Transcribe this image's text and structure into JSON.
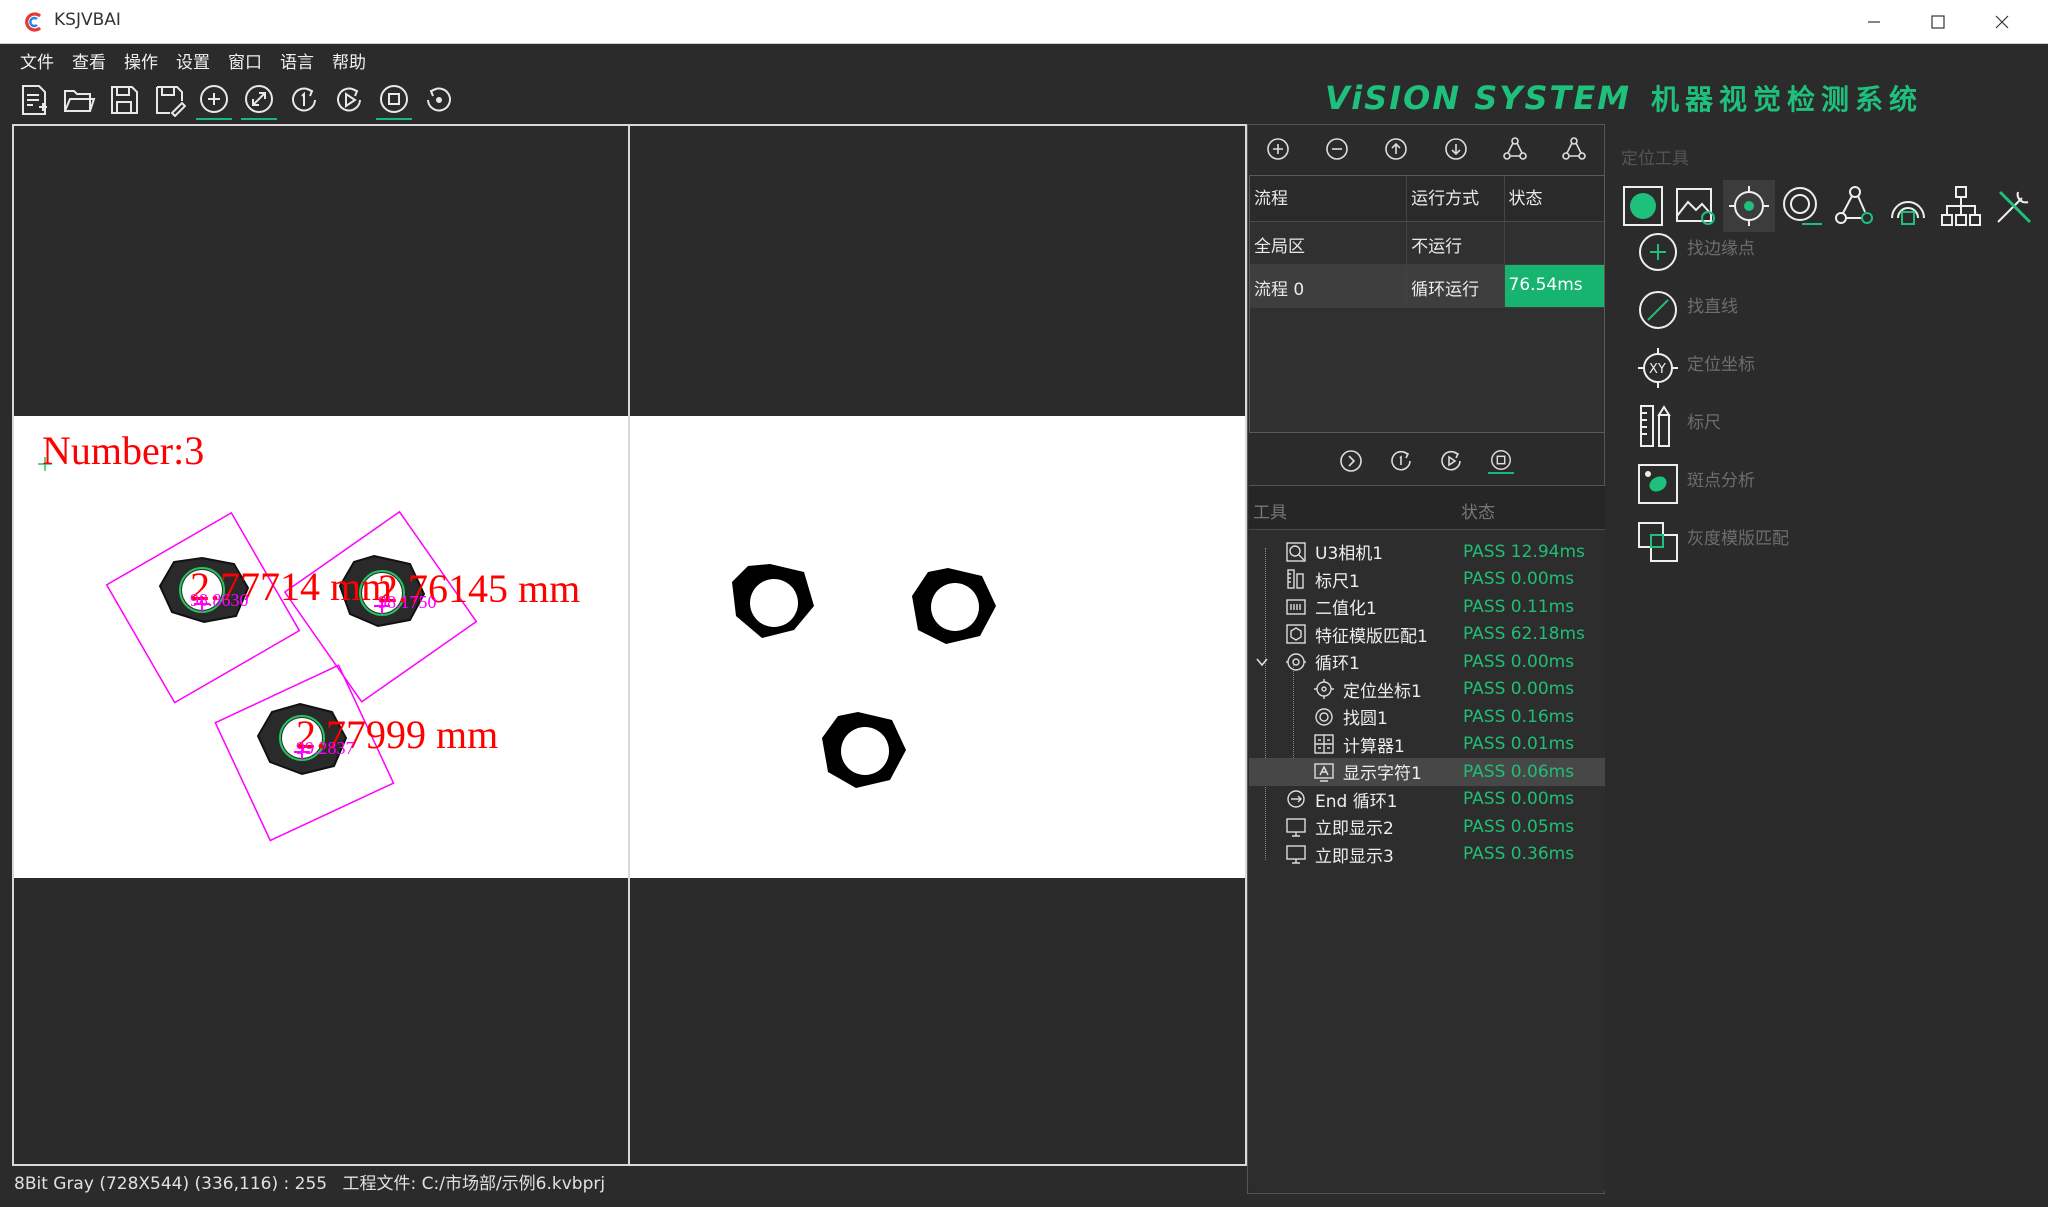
{
  "window": {
    "title": "KSJVBAI"
  },
  "menu": [
    "文件",
    "查看",
    "操作",
    "设置",
    "窗口",
    "语言",
    "帮助"
  ],
  "brand": {
    "en": "ViSION SYSTEM",
    "cn": "机器视觉检测系统"
  },
  "colors": {
    "accent": "#17b978",
    "background": "#2b2b2b",
    "overlay_text": "#ff0000",
    "overlay_shape": "#ff00ff"
  },
  "overlay": {
    "count_label": "Number:3",
    "measurements": [
      "2.77714 mm",
      "2.76145 mm",
      "2.77999 mm"
    ],
    "scores": [
      "98.8630",
      "98.1750",
      "99.2837"
    ]
  },
  "flow_table": {
    "headers": [
      "流程",
      "运行方式",
      "状态"
    ],
    "rows": [
      {
        "name": "全局区",
        "mode": "不运行",
        "status": ""
      },
      {
        "name": "流程 0",
        "mode": "循环运行",
        "status": "76.54ms"
      }
    ]
  },
  "tool_table": {
    "headers": [
      "工具",
      "状态"
    ],
    "rows": [
      {
        "name": "U3相机1",
        "status": "PASS 12.94ms"
      },
      {
        "name": "标尺1",
        "status": "PASS 0.00ms"
      },
      {
        "name": "二值化1",
        "status": "PASS 0.11ms"
      },
      {
        "name": "特征模版匹配1",
        "status": "PASS 62.18ms"
      },
      {
        "name": "循环1",
        "status": "PASS 0.00ms"
      },
      {
        "name": "定位坐标1",
        "status": "PASS 0.00ms"
      },
      {
        "name": "找圆1",
        "status": "PASS 0.16ms"
      },
      {
        "name": "计算器1",
        "status": "PASS 0.01ms"
      },
      {
        "name": "显示字符1",
        "status": "PASS 0.06ms"
      },
      {
        "name": "End 循环1",
        "status": "PASS 0.00ms"
      },
      {
        "name": "立即显示2",
        "status": "PASS 0.05ms"
      },
      {
        "name": "立即显示3",
        "status": "PASS 0.36ms"
      }
    ]
  },
  "tool_panel": {
    "title": "定位工具",
    "items": [
      "找边缘点",
      "找直线",
      "定位坐标",
      "标尺",
      "斑点分析",
      "灰度模版匹配"
    ]
  },
  "status_bar": {
    "image_info": "8Bit Gray (728X544) (336,116) : 255",
    "project_file": "工程文件: C:/市场部/示例6.kvbprj"
  }
}
